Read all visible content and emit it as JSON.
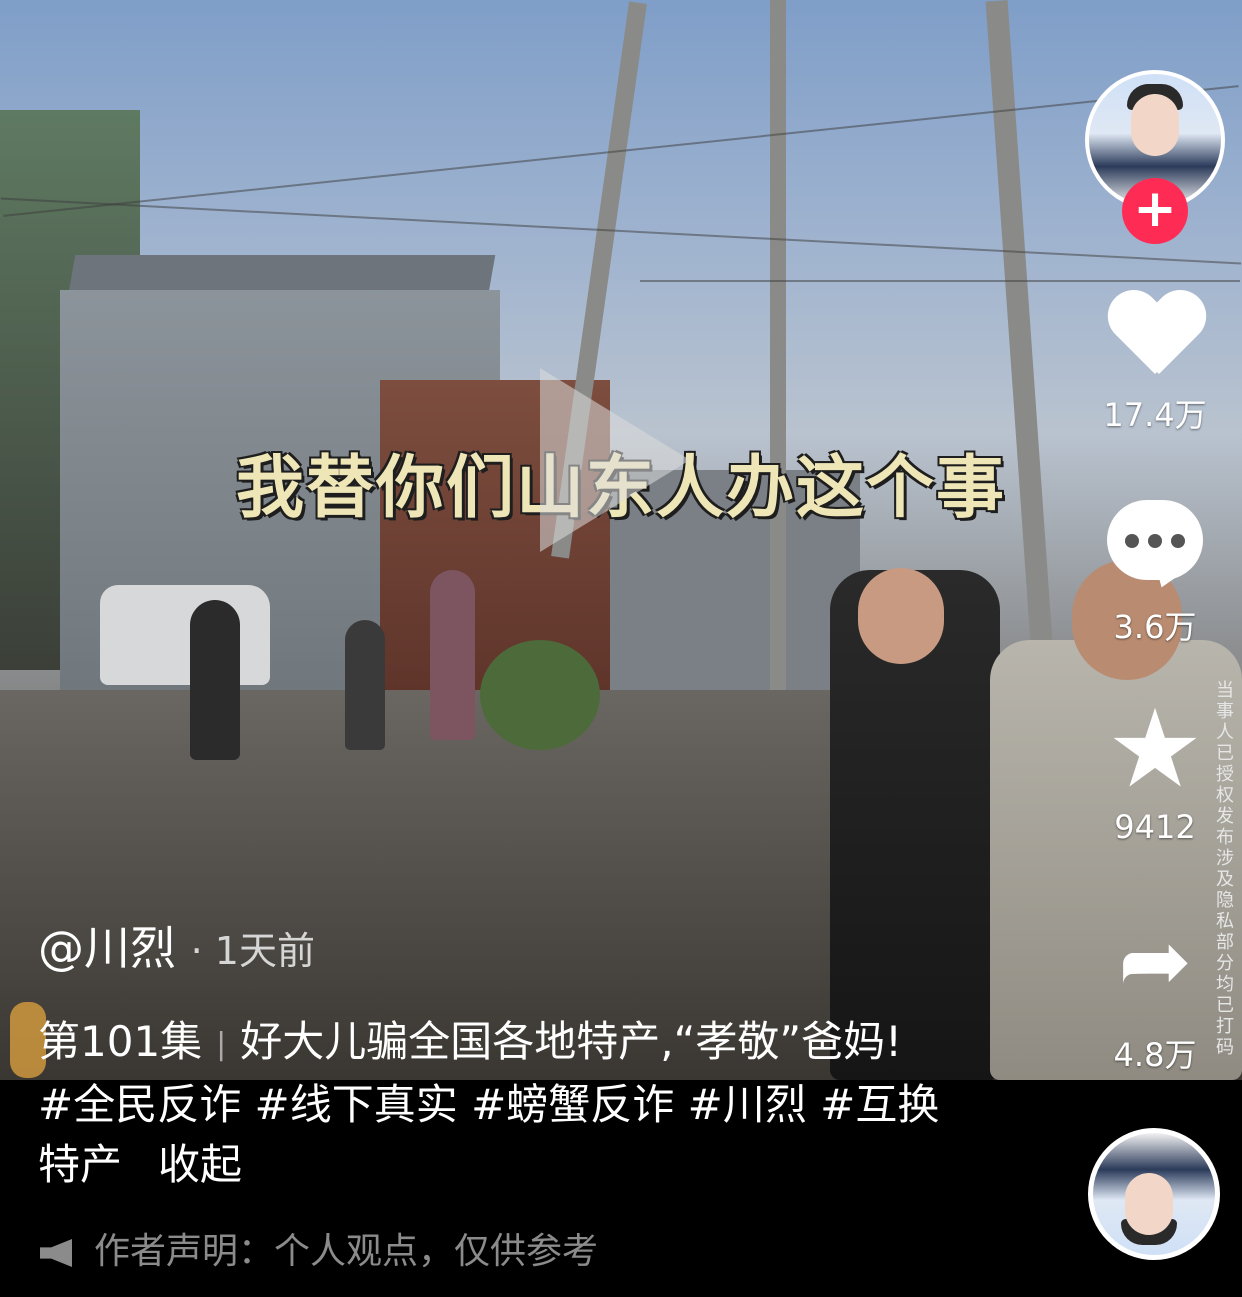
{
  "video": {
    "caption": "我替你们山东人办这个事",
    "watermark": "当事人已授权发布涉及隐私部分均已打码"
  },
  "sidebar": {
    "follow_icon": "+",
    "like_count": "17.4万",
    "comment_count": "3.6万",
    "favorite_count": "9412",
    "share_count": "4.8万"
  },
  "post": {
    "author": "@川烈",
    "time": "· 1天前",
    "episode": "第101集",
    "title": "好大儿骗全国各地特产,“孝敬”爸妈!",
    "hashtags_line": "#全民反诈 #线下真实 #螃蟹反诈 #川烈 #互换",
    "hashtags_line2": "特产",
    "collapse": "收起",
    "notice": "作者声明：个人观点，仅供参考"
  },
  "colors": {
    "follow_red": "#fe2c55",
    "caption_yellow": "#efe6b8",
    "notice_gray": "#8b8b8b"
  }
}
